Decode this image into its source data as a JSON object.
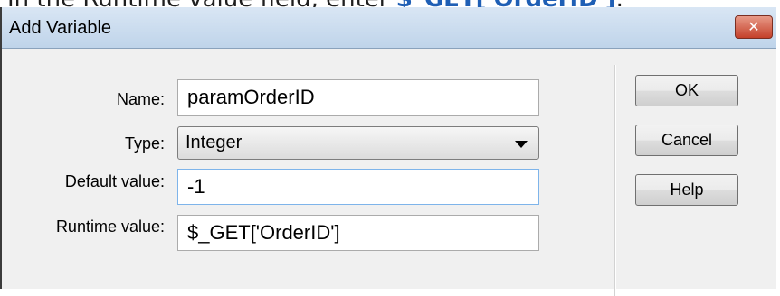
{
  "caption": {
    "prefix": "In the Runtime value field, enter ",
    "code": "$_GET['OrderID']",
    "suffix": "."
  },
  "dialog": {
    "title": "Add Variable",
    "close_symbol": "✕",
    "name_label": "Name:",
    "name_value": "paramOrderID",
    "type_label": "Type:",
    "type_value": "Integer",
    "default_label": "Default value:",
    "default_value": "-1",
    "runtime_label": "Runtime value:",
    "runtime_value": "$_GET['OrderID']"
  },
  "buttons": {
    "ok": "OK",
    "cancel": "Cancel",
    "help": "Help"
  },
  "icons": {
    "close": "close-icon",
    "dropdown": "chevron-down-icon"
  }
}
